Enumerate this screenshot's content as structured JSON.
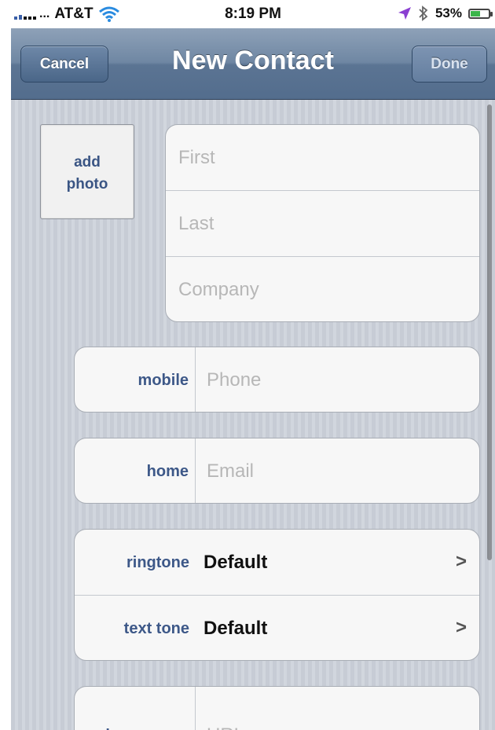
{
  "status_bar": {
    "carrier": "AT&T",
    "carrier_prefix": "...",
    "time": "8:19 PM",
    "battery": "53%",
    "battery_level": 0.53,
    "icons": [
      "signal-icon",
      "wifi-icon",
      "location-icon",
      "bluetooth-icon",
      "battery-icon"
    ]
  },
  "nav": {
    "cancel_label": "Cancel",
    "title": "New Contact",
    "done_label": "Done"
  },
  "photo": {
    "label_line1": "add",
    "label_line2": "photo"
  },
  "name_fields": {
    "first_placeholder": "First",
    "last_placeholder": "Last",
    "company_placeholder": "Company"
  },
  "phone": {
    "label": "mobile",
    "placeholder": "Phone"
  },
  "email": {
    "label": "home",
    "placeholder": "Email"
  },
  "tones": {
    "ringtone_label": "ringtone",
    "ringtone_value": "Default",
    "texttone_label": "text tone",
    "texttone_value": "Default"
  },
  "url": {
    "label": "home page",
    "placeholder": "URL"
  },
  "colors": {
    "nav_bar": "#6f87a3",
    "label_blue": "#3d5888",
    "background_stripe": "#c7ccd5",
    "location_arrow": "#8a3fd1",
    "battery_fill": "#3bb54a"
  }
}
